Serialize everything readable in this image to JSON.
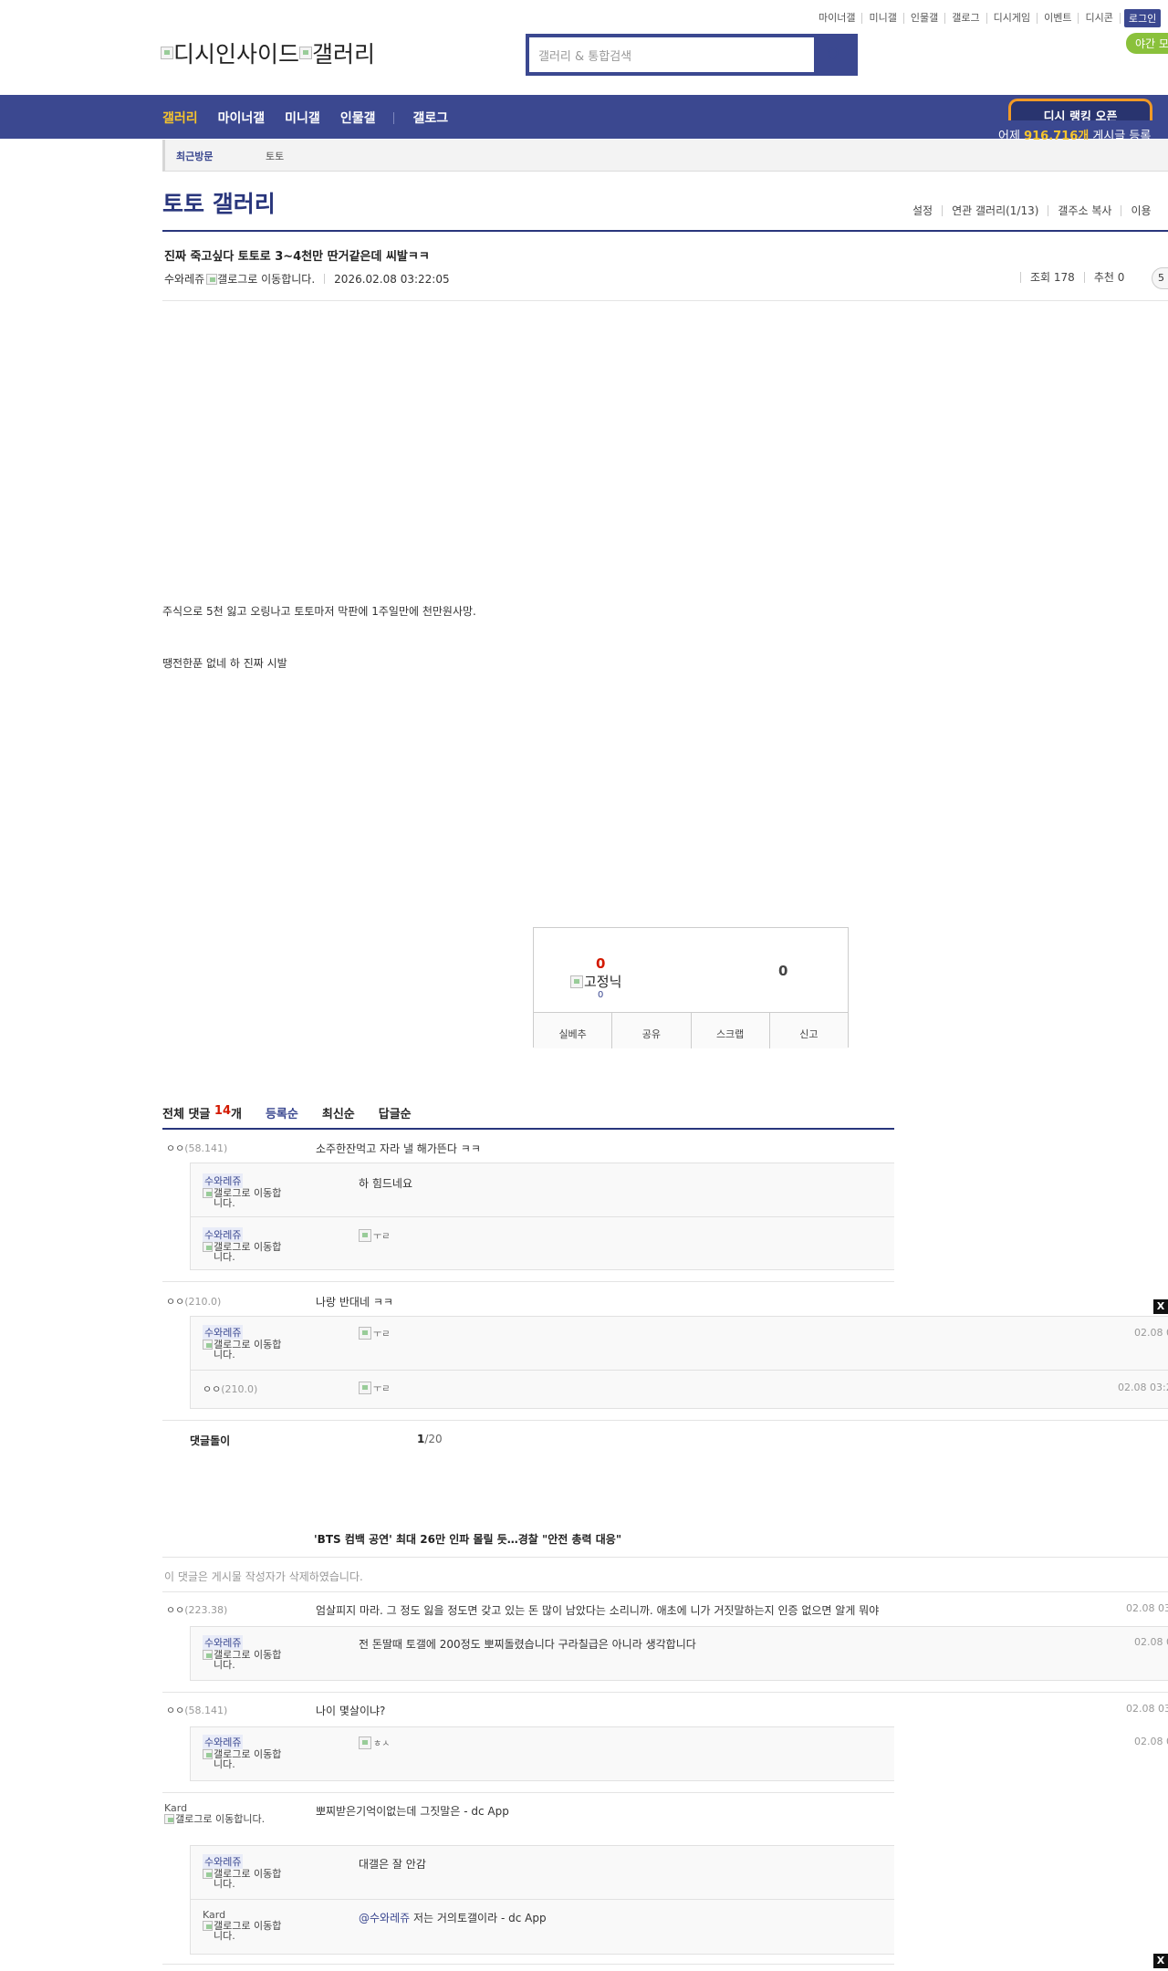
{
  "top_links": [
    "마이너갤",
    "미니갤",
    "인물갤",
    "갤로그",
    "디시게임",
    "이벤트",
    "디시콘"
  ],
  "login_label": "로그인",
  "night_mode_label": "야간 모",
  "logo_text_1": "디시인사이드",
  "logo_text_2": "갤러리",
  "search": {
    "placeholder": "갤러리 & 통합검색"
  },
  "nav": {
    "items": [
      "갤러리",
      "마이너갤",
      "미니갤",
      "인물갤"
    ],
    "gallog": "갤로그",
    "ranking": "디시 랭킹 오픈",
    "yesterday_prefix": "어제",
    "yesterday_count": "916,716개",
    "yesterday_suffix": "게시글 등록"
  },
  "recent": {
    "label": "최근방문",
    "item": "토토"
  },
  "gallery": {
    "title": "토토 갤러리",
    "tools": [
      "설정",
      "연관 갤러리(1/13)",
      "갤주소 복사",
      "이용"
    ]
  },
  "post": {
    "title": "진짜 죽고싶다 토토로 3~4천만 딴거같은데 씨발ㅋㅋ",
    "writer": "수와레쥬",
    "gallog_alt": "갤로그로 이동합니다.",
    "date": "2026.02.08 03:22:05",
    "views": "조회 178",
    "recommend": "추천 0",
    "comment_badge": "5",
    "body_1": "주식으로 5천 잃고 오링나고 토토마저 막판에 1주일만에 천만원사망.",
    "body_2": "땡전한푼 없네 하 진짜 시발"
  },
  "recommend_box": {
    "up": "0",
    "fixed_label": "고정닉",
    "fixed_count": "0",
    "down": "0",
    "buttons": [
      "실베추",
      "공유",
      "스크랩",
      "신고"
    ]
  },
  "comments": {
    "header_prefix": "전체 댓글",
    "count": "14",
    "unit": "개",
    "tabs": [
      "등록순",
      "최신순",
      "답글순"
    ],
    "gallog_alt": "갤로그로 이동합니다.",
    "c1": {
      "nick": "ㅇㅇ",
      "ip": "(58.141)",
      "text": "소주한잔먹고 자라 낼 해가뜬다 ㅋㅋ"
    },
    "c1r1": {
      "nick": "수와레쥬",
      "text": "하 힘드네요"
    },
    "c1r2": {
      "nick": "수와레쥬",
      "emo": "ㅜㄹ"
    },
    "c2": {
      "nick": "ㅇㅇ",
      "ip": "(210.0)",
      "text": "나랑 반대네 ㅋㅋ"
    },
    "c2r1": {
      "nick": "수와레쥬",
      "emo": "ㅜㄹ",
      "date": "02.08 0"
    },
    "c2r2": {
      "nick": "ㅇㅇ",
      "ip": "(210.0)",
      "emo": "ㅜㄹ",
      "date": "02.08 03:2"
    },
    "bot_label": "댓글돌이",
    "pager": "1",
    "pager_total": "/20",
    "ad_title": "'BTS 컴백 공연' 최대 26만 인파 몰릴 듯…경찰 \"안전 총력 대응\"",
    "deleted": "이 댓글은 게시물 작성자가 삭제하였습니다.",
    "c3": {
      "nick": "ㅇㅇ",
      "ip": "(223.38)",
      "text": "엄살피지 마라. 그 정도 잃을 정도면 갖고 있는 돈 많이 남았다는 소리니까. 애초에 니가 거짓말하는지 인증 없으면 알게 뭐야",
      "date": "02.08 03"
    },
    "c3r1": {
      "nick": "수와레쥬",
      "text": "전 돈딸때 토갤에 200정도 뽀찌돌렸습니다 구라칠급은 아니라 생각합니다",
      "date": "02.08 0"
    },
    "c4": {
      "nick": "ㅇㅇ",
      "ip": "(58.141)",
      "text": "나이 몇살이냐?",
      "date": "02.08 03"
    },
    "c4r1": {
      "nick": "수와레쥬",
      "emo": "ㅎㅅ",
      "date": "02.08 0"
    },
    "c5": {
      "nick": "Kard",
      "text": "뽀찌받은기억이없는데 그짓말은 - dc App"
    },
    "c5r1": {
      "nick": "수와레쥬",
      "text": "대갤은 잘 안감"
    },
    "c5r2": {
      "nick": "Kard",
      "mention": "@수와레쥬",
      "text": "저는 거의토갤이라 - dc App"
    }
  },
  "close_label": "X",
  "colors": {
    "brand": "#3b4890",
    "accent": "#f7c52c",
    "red": "#d31900",
    "night": "#8ac13b"
  }
}
